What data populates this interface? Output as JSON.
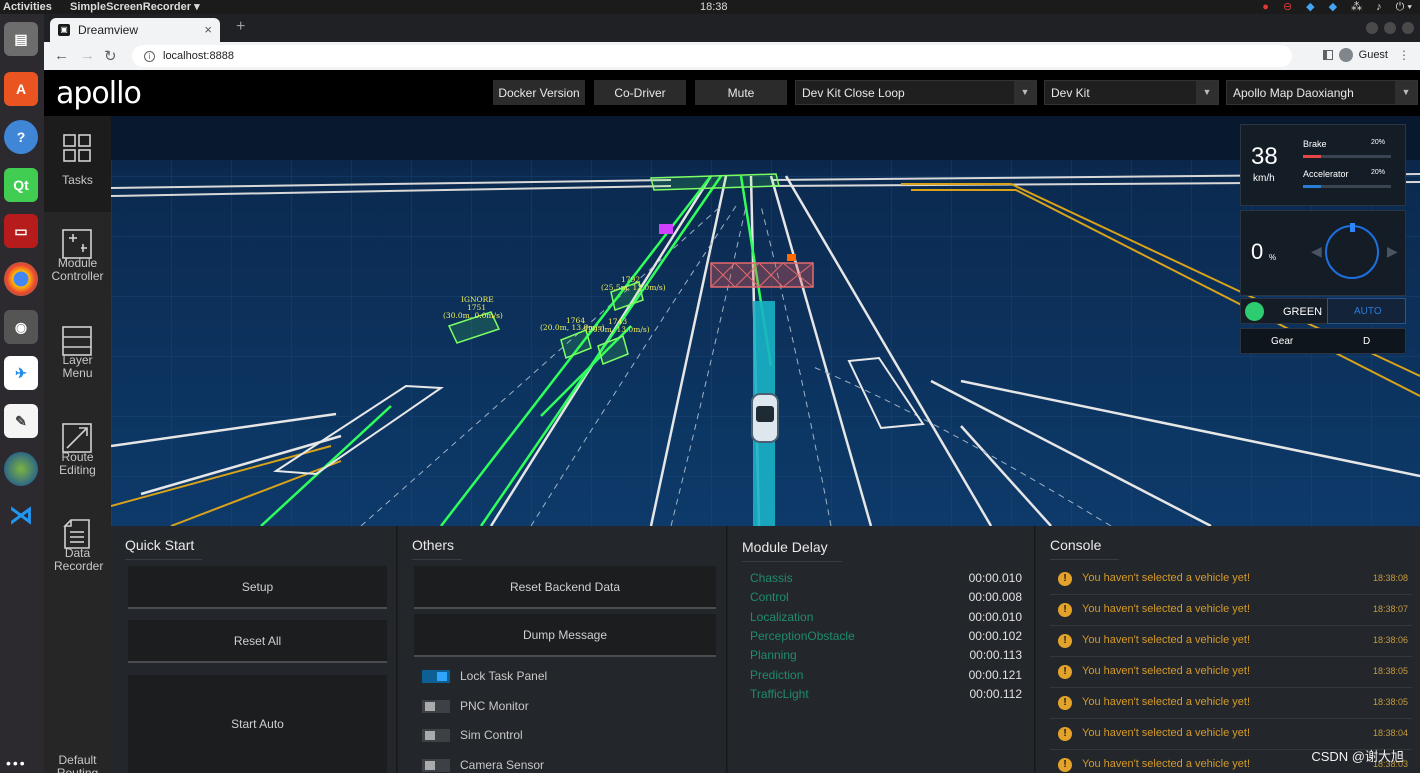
{
  "topbar": {
    "activities": "Activities",
    "app_menu": "SimpleScreenRecorder ▾",
    "clock": "18:38",
    "tray_icons": [
      "record-icon",
      "stop-icon",
      "shield-icon",
      "shield-icon",
      "network-icon",
      "volume-icon",
      "power-icon"
    ]
  },
  "browser": {
    "tab_title": "Dreamview",
    "tab_close": "×",
    "new_tab": "+",
    "url": "localhost:8888",
    "profile": "Guest"
  },
  "dreamview": {
    "logo": "apollo",
    "header_buttons": [
      "Docker Version",
      "Co-Driver",
      "Mute"
    ],
    "mode_select": "Dev Kit Close Loop",
    "vehicle_select": "Dev Kit",
    "map_select": "Apollo Map Daoxiangh",
    "side_menu": [
      {
        "label": "Tasks",
        "icon": "grid-icon"
      },
      {
        "label": "Module Controller",
        "icon": "controls-icon"
      },
      {
        "label": "Layer Menu",
        "icon": "layers-icon"
      },
      {
        "label": "Route Editing",
        "icon": "route-icon"
      },
      {
        "label": "Data Recorder",
        "icon": "document-icon"
      },
      {
        "label": "Default Routing",
        "icon": "routing-icon"
      }
    ]
  },
  "hud": {
    "speed": "38",
    "speed_unit": "km/h",
    "brake_label": "Brake",
    "brake_pct": "20%",
    "brake_level": 0.2,
    "accel_label": "Accelerator",
    "accel_pct": "20%",
    "accel_level": 0.2,
    "steer_value": "0",
    "steer_unit": "%",
    "signal_text": "GREEN",
    "signal_color": "#2ecc71",
    "drive_mode": "AUTO",
    "gear_label": "Gear",
    "gear_value": "D"
  },
  "scene_labels": {
    "obstacle_a": "IGNORE",
    "obstacle_a_id": "1751",
    "obstacle_a_info": "(30.0m, 0.0m/s)",
    "obstacle_b_id": "1764",
    "obstacle_b_info": "(20.0m, 13.0m/s)",
    "obstacle_c_id": "1743",
    "obstacle_c_info": "(20.0m, 13.0m/s)",
    "obstacle_d_id": "1792",
    "obstacle_d_info": "(25.5m, 13.0m/s)"
  },
  "quick_start": {
    "title": "Quick Start",
    "buttons": [
      "Setup",
      "Reset All",
      "Start Auto"
    ]
  },
  "others": {
    "title": "Others",
    "buttons": [
      "Reset Backend Data",
      "Dump Message"
    ],
    "toggles": [
      {
        "label": "Lock Task Panel",
        "on": true
      },
      {
        "label": "PNC Monitor",
        "on": false
      },
      {
        "label": "Sim Control",
        "on": false
      },
      {
        "label": "Camera Sensor",
        "on": false
      }
    ]
  },
  "module_delay": {
    "title": "Module Delay",
    "rows": [
      {
        "name": "Chassis",
        "value": "00:00.010"
      },
      {
        "name": "Control",
        "value": "00:00.008"
      },
      {
        "name": "Localization",
        "value": "00:00.010"
      },
      {
        "name": "PerceptionObstacle",
        "value": "00:00.102"
      },
      {
        "name": "Planning",
        "value": "00:00.113"
      },
      {
        "name": "Prediction",
        "value": "00:00.121"
      },
      {
        "name": "TrafficLight",
        "value": "00:00.112"
      }
    ]
  },
  "console": {
    "title": "Console",
    "messages": [
      {
        "text": "You haven't selected a vehicle yet!",
        "time": "18:38:08"
      },
      {
        "text": "You haven't selected a vehicle yet!",
        "time": "18:38:07"
      },
      {
        "text": "You haven't selected a vehicle yet!",
        "time": "18:38:06"
      },
      {
        "text": "You haven't selected a vehicle yet!",
        "time": "18:38:05"
      },
      {
        "text": "You haven't selected a vehicle yet!",
        "time": "18:38:05"
      },
      {
        "text": "You haven't selected a vehicle yet!",
        "time": "18:38:04"
      },
      {
        "text": "You haven't selected a vehicle yet!",
        "time": "18:38:03"
      }
    ]
  },
  "watermark": "CSDN @谢大旭",
  "colors": {
    "scene_bg": "#0d2f56",
    "lane_green": "#2fff5a",
    "delay_green": "#1f8c6f",
    "warning": "#e3a32a",
    "accent_blue": "#1e88e5"
  }
}
